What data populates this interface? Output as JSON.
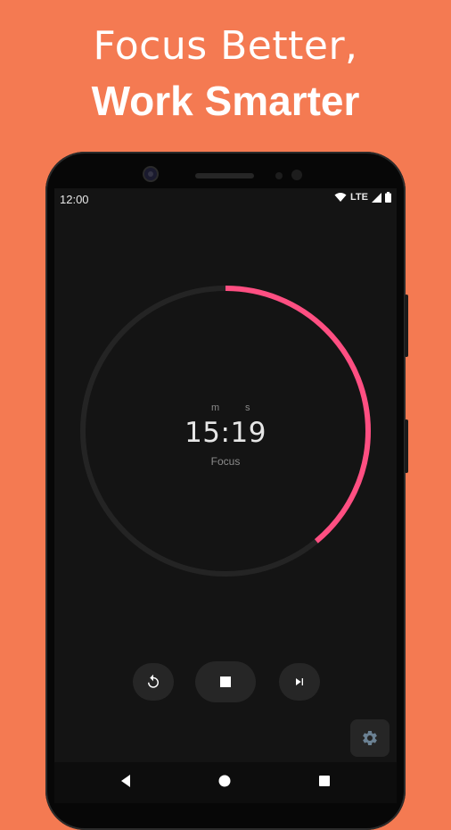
{
  "promo": {
    "line1": "Focus Better,",
    "line2": "Work Smarter"
  },
  "status_bar": {
    "time": "12:00",
    "network": "LTE",
    "icons": [
      "wifi-icon",
      "signal-icon",
      "battery-icon"
    ]
  },
  "timer": {
    "minutes_unit": "m",
    "seconds_unit": "s",
    "time": "15:19",
    "session": "Focus",
    "progress_fraction": 0.39,
    "track_color": "#242424",
    "progress_color": "#FF4F82"
  },
  "controls": {
    "reset": "reset-icon",
    "stop": "stop-icon",
    "skip": "skip-next-icon",
    "settings": "gear-icon"
  },
  "nav": {
    "back": "back-icon",
    "home": "home-icon",
    "recents": "recents-icon"
  },
  "colors": {
    "background": "#F47A52",
    "screen": "#141414",
    "accent": "#FF4F82"
  }
}
